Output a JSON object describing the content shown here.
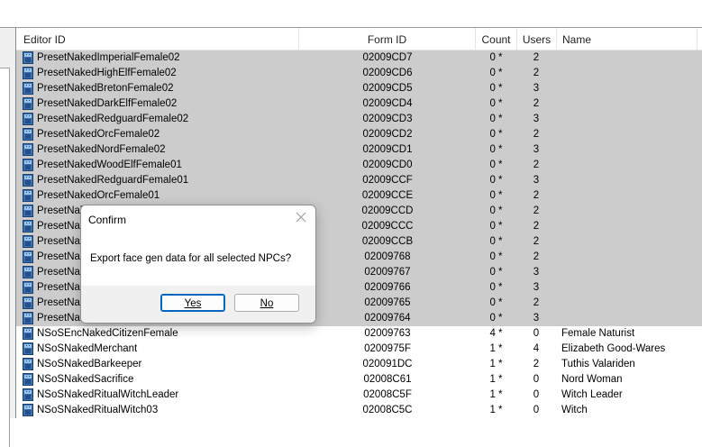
{
  "list": {
    "columns": {
      "editor_id": "Editor ID",
      "form_id": "Form ID",
      "count": "Count",
      "users": "Users",
      "name": "Name"
    },
    "rows": [
      {
        "editor_id": "PresetNakedImperialFemale02",
        "form_id": "02009CD7",
        "count": "0 *",
        "users": "2",
        "name": "",
        "selected": true
      },
      {
        "editor_id": "PresetNakedHighElfFemale02",
        "form_id": "02009CD6",
        "count": "0 *",
        "users": "2",
        "name": "",
        "selected": true
      },
      {
        "editor_id": "PresetNakedBretonFemale02",
        "form_id": "02009CD5",
        "count": "0 *",
        "users": "3",
        "name": "",
        "selected": true
      },
      {
        "editor_id": "PresetNakedDarkElfFemale02",
        "form_id": "02009CD4",
        "count": "0 *",
        "users": "2",
        "name": "",
        "selected": true
      },
      {
        "editor_id": "PresetNakedRedguardFemale02",
        "form_id": "02009CD3",
        "count": "0 *",
        "users": "3",
        "name": "",
        "selected": true
      },
      {
        "editor_id": "PresetNakedOrcFemale02",
        "form_id": "02009CD2",
        "count": "0 *",
        "users": "2",
        "name": "",
        "selected": true
      },
      {
        "editor_id": "PresetNakedNordFemale02",
        "form_id": "02009CD1",
        "count": "0 *",
        "users": "3",
        "name": "",
        "selected": true
      },
      {
        "editor_id": "PresetNakedWoodElfFemale01",
        "form_id": "02009CD0",
        "count": "0 *",
        "users": "2",
        "name": "",
        "selected": true
      },
      {
        "editor_id": "PresetNakedRedguardFemale01",
        "form_id": "02009CCF",
        "count": "0 *",
        "users": "3",
        "name": "",
        "selected": true
      },
      {
        "editor_id": "PresetNakedOrcFemale01",
        "form_id": "02009CCE",
        "count": "0 *",
        "users": "2",
        "name": "",
        "selected": true
      },
      {
        "editor_id": "PresetNak",
        "form_id": "02009CCD",
        "count": "0 *",
        "users": "2",
        "name": "",
        "selected": true
      },
      {
        "editor_id": "PresetNak",
        "form_id": "02009CCC",
        "count": "0 *",
        "users": "2",
        "name": "",
        "selected": true
      },
      {
        "editor_id": "PresetNak",
        "form_id": "02009CCB",
        "count": "0 *",
        "users": "2",
        "name": "",
        "selected": true
      },
      {
        "editor_id": "PresetNak",
        "form_id": "02009768",
        "count": "0 *",
        "users": "2",
        "name": "",
        "selected": true
      },
      {
        "editor_id": "PresetNak",
        "form_id": "02009767",
        "count": "0 *",
        "users": "3",
        "name": "",
        "selected": true
      },
      {
        "editor_id": "PresetNak",
        "form_id": "02009766",
        "count": "0 *",
        "users": "3",
        "name": "",
        "selected": true
      },
      {
        "editor_id": "PresetNak",
        "form_id": "02009765",
        "count": "0 *",
        "users": "2",
        "name": "",
        "selected": true
      },
      {
        "editor_id": "PresetNak",
        "form_id": "02009764",
        "count": "0 *",
        "users": "3",
        "name": "",
        "selected": true
      },
      {
        "editor_id": "NSoSEncNakedCitizenFemale",
        "form_id": "02009763",
        "count": "4 *",
        "users": "0",
        "name": "Female Naturist",
        "selected": false
      },
      {
        "editor_id": "NSoSNakedMerchant",
        "form_id": "0200975F",
        "count": "1 *",
        "users": "4",
        "name": "Elizabeth Good-Wares",
        "selected": false
      },
      {
        "editor_id": "NSoSNakedBarkeeper",
        "form_id": "020091DC",
        "count": "1 *",
        "users": "2",
        "name": "Tuthis Valariden",
        "selected": false
      },
      {
        "editor_id": "NSoSNakedSacrifice",
        "form_id": "02008C61",
        "count": "1 *",
        "users": "0",
        "name": "Nord Woman",
        "selected": false
      },
      {
        "editor_id": "NSoSNakedRitualWitchLeader",
        "form_id": "02008C5F",
        "count": "1 *",
        "users": "0",
        "name": "Witch Leader",
        "selected": false
      },
      {
        "editor_id": "NSoSNakedRitualWitch03",
        "form_id": "02008C5C",
        "count": "1 *",
        "users": "0",
        "name": "Witch",
        "selected": false
      }
    ]
  },
  "dialog": {
    "title": "Confirm",
    "message": "Export face gen data for all selected NPCs?",
    "yes_label": "Yes",
    "no_label": "No"
  },
  "colors": {
    "selected_row": "#cccccc",
    "primary_button_border": "#0067c0",
    "dialog_footer": "#f0f0f0"
  },
  "icons": {
    "row_icon": "npc-icon",
    "dialog_close": "close-icon"
  }
}
